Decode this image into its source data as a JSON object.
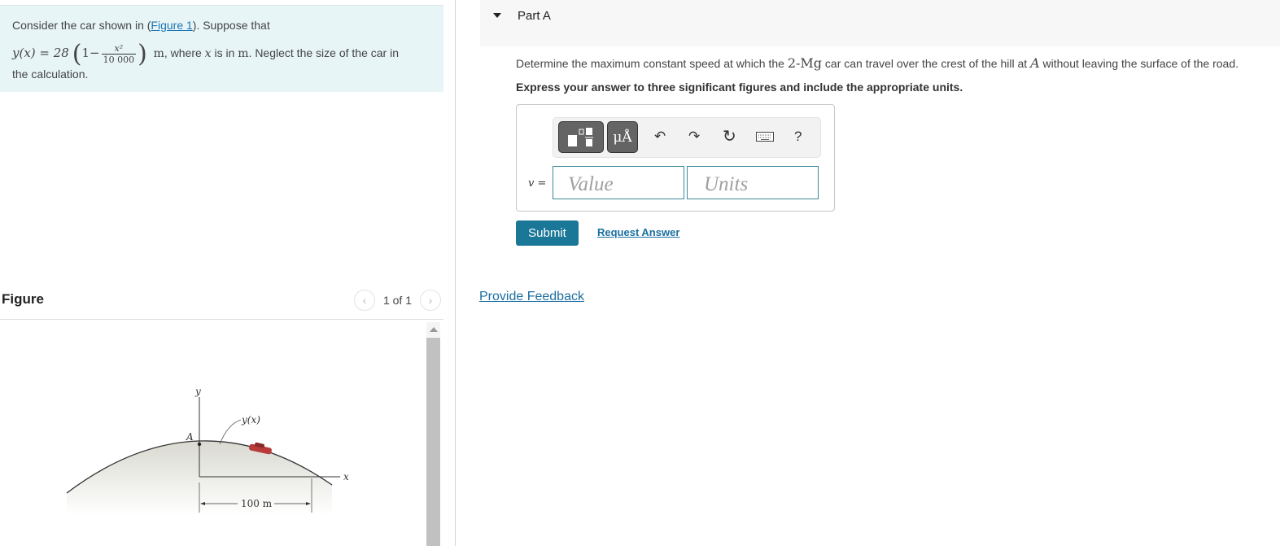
{
  "problem": {
    "intro_prefix": "Consider the car shown in (",
    "figure_link": "Figure 1",
    "intro_suffix": "). Suppose that",
    "equation_lhs": "y(x) = 28",
    "equation_one": "1−",
    "frac_num": "x²",
    "frac_den": "10 000",
    "unit_m": "m",
    "eq_text_1": ", where ",
    "eq_var_x": "x",
    "eq_text_2": " is in ",
    "eq_text_3": ". Neglect the size of the car in",
    "line3": "the calculation."
  },
  "figure": {
    "title": "Figure",
    "pager": "1 of 1",
    "prev_icon": "‹",
    "next_icon": "›",
    "labels": {
      "y_axis": "y",
      "x_axis": "x",
      "curve": "y(x)",
      "point": "A",
      "dimension": "100 m"
    }
  },
  "part": {
    "title": "Part A",
    "question_prefix": "Determine the maximum constant speed at which the ",
    "question_mass": "2-Mg",
    "question_mid": " car can travel over the crest of the hill at ",
    "question_point": "A",
    "question_suffix": " without leaving the surface of the road.",
    "instruction": "Express your answer to three significant figures and include the appropriate units."
  },
  "answer": {
    "variable_label": "v =",
    "value_placeholder": "Value",
    "units_placeholder": "Units",
    "toolbar": {
      "units_button": "μÅ",
      "undo_icon": "↶",
      "redo_icon": "↷",
      "reset_icon": "↻",
      "help_label": "?"
    },
    "submit_label": "Submit",
    "request_label": "Request Answer"
  },
  "feedback_label": "Provide Feedback"
}
